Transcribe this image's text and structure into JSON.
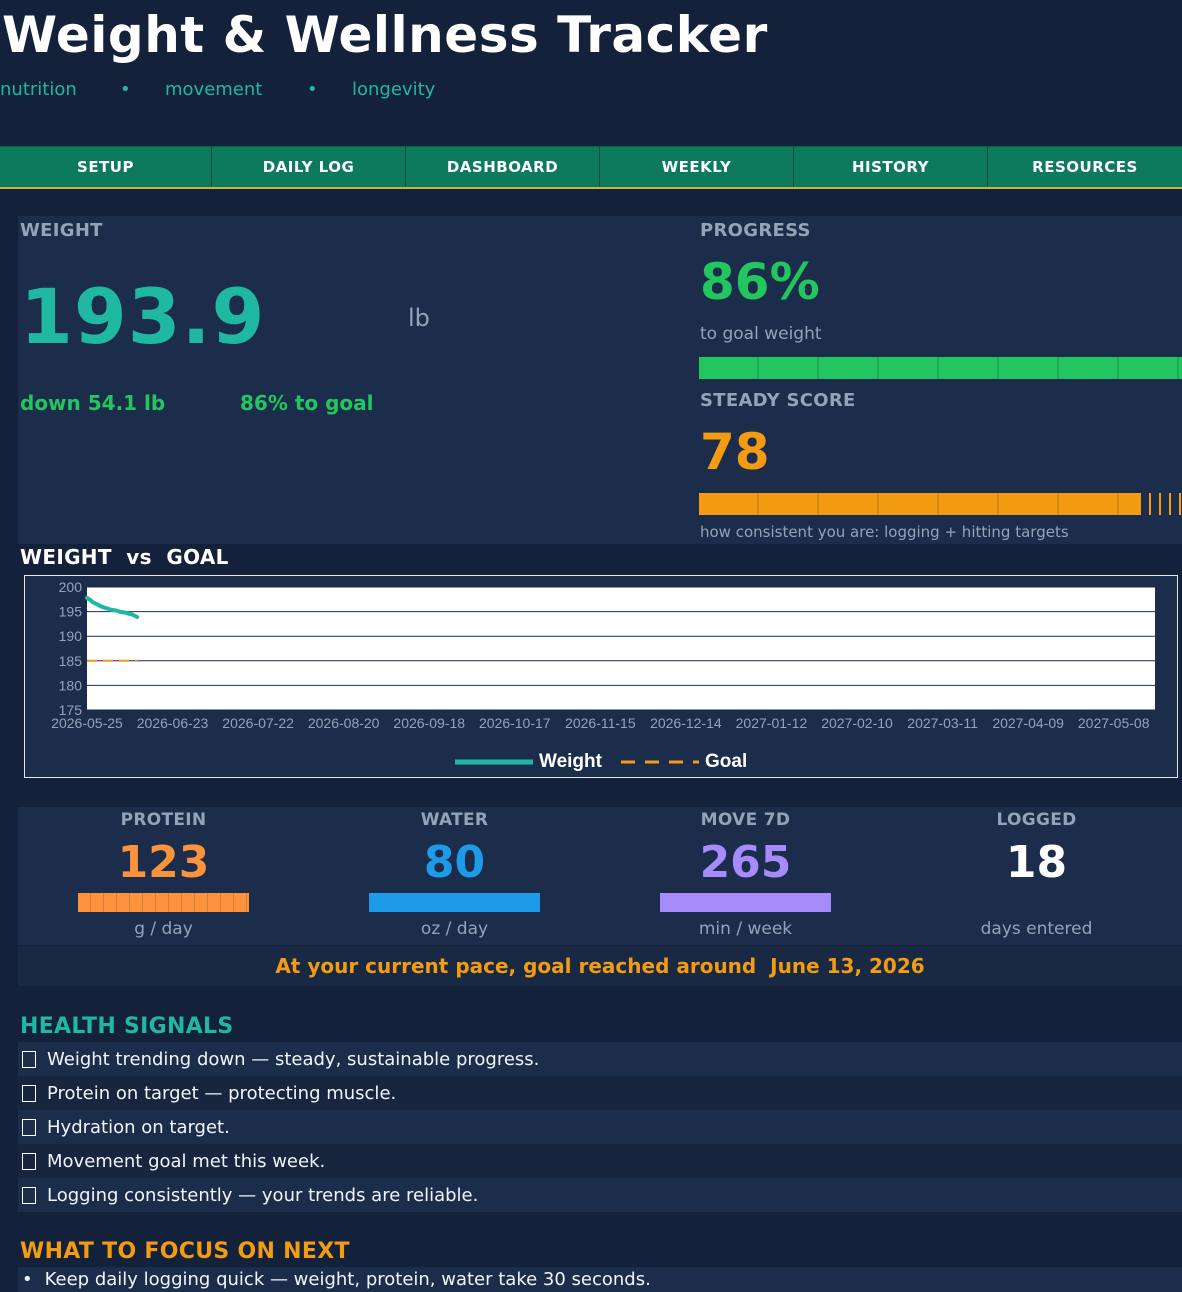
{
  "app": {
    "title": "Weight & Wellness Tracker",
    "subtitle": [
      "nutrition",
      "movement",
      "longevity"
    ],
    "subtitle_separator": "•"
  },
  "tabs": [
    "SETUP",
    "DAILY LOG",
    "DASHBOARD",
    "WEEKLY",
    "HISTORY",
    "RESOURCES"
  ],
  "weight": {
    "label": "WEIGHT",
    "value": "193.9",
    "unit": "lb",
    "down_text": "down 54.1 lb",
    "to_goal_text": "86% to goal"
  },
  "progress": {
    "label": "PROGRESS",
    "value": "86%",
    "caption": "to goal weight",
    "fraction": 1.0,
    "color": "#22c55e"
  },
  "steady": {
    "label": "STEADY SCORE",
    "value": "78",
    "caption": "how consistent you are: logging + hitting targets",
    "fraction": 0.915,
    "color": "#f39c12"
  },
  "chart_title": "WEIGHT  vs  GOAL",
  "chart_data": {
    "type": "line",
    "ylim": [
      175,
      200
    ],
    "yticks": [
      200,
      195,
      190,
      185,
      180,
      175
    ],
    "xlim": [
      "2026-05-25",
      "2027-05-22"
    ],
    "xticks": [
      "2026-05-25",
      "2026-06-23",
      "2026-07-22",
      "2026-08-20",
      "2026-09-18",
      "2026-10-17",
      "2026-11-15",
      "2026-12-14",
      "2027-01-12",
      "2027-02-10",
      "2027-03-11",
      "2027-04-09",
      "2027-05-08"
    ],
    "grid": true,
    "legend": "bottom-center",
    "series": [
      {
        "name": "Weight",
        "color": "#1fb8a2",
        "style": "solid",
        "x": [
          "2026-05-25",
          "2026-05-26",
          "2026-05-27",
          "2026-05-28",
          "2026-05-29",
          "2026-05-30",
          "2026-05-31",
          "2026-06-01",
          "2026-06-02",
          "2026-06-03",
          "2026-06-04",
          "2026-06-05",
          "2026-06-06",
          "2026-06-07",
          "2026-06-08",
          "2026-06-09",
          "2026-06-10",
          "2026-06-11"
        ],
        "y": [
          197.8,
          197.4,
          196.9,
          196.6,
          196.3,
          196.0,
          195.8,
          195.6,
          195.4,
          195.3,
          195.2,
          195.0,
          194.9,
          194.8,
          194.6,
          194.5,
          194.2,
          193.9
        ]
      },
      {
        "name": "Goal",
        "color": "#f39c12",
        "style": "dashed",
        "x": [
          "2026-05-25",
          "2026-06-11"
        ],
        "y": [
          185,
          185
        ]
      }
    ]
  },
  "metrics": [
    {
      "label": "PROTEIN",
      "value": "123",
      "unit": "g / day",
      "color": "#fb923c",
      "bar_fraction": 1.0,
      "bar_style": "segmented"
    },
    {
      "label": "WATER",
      "value": "80",
      "unit": "oz / day",
      "color": "#1e9be8",
      "bar_fraction": 1.0,
      "bar_style": "solid"
    },
    {
      "label": "MOVE 7D",
      "value": "265",
      "unit": "min / week",
      "color": "#a78bfa",
      "bar_fraction": 1.0,
      "bar_style": "solid"
    },
    {
      "label": "LOGGED",
      "value": "18",
      "unit": "days entered",
      "color": "#ffffff"
    }
  ],
  "pace": {
    "text": "At your current pace, goal reached around  June 13, 2026"
  },
  "signals": {
    "title": "HEALTH SIGNALS",
    "items": [
      "Weight trending down — steady, sustainable progress.",
      "Protein on target — protecting muscle.",
      "Hydration on target.",
      "Movement goal met this week.",
      "Logging consistently — your trends are reliable."
    ]
  },
  "focus": {
    "title": "WHAT TO FOCUS ON NEXT",
    "bullet": "•",
    "items": [
      "Keep daily logging quick — weight, protein, water take 30 seconds."
    ]
  }
}
